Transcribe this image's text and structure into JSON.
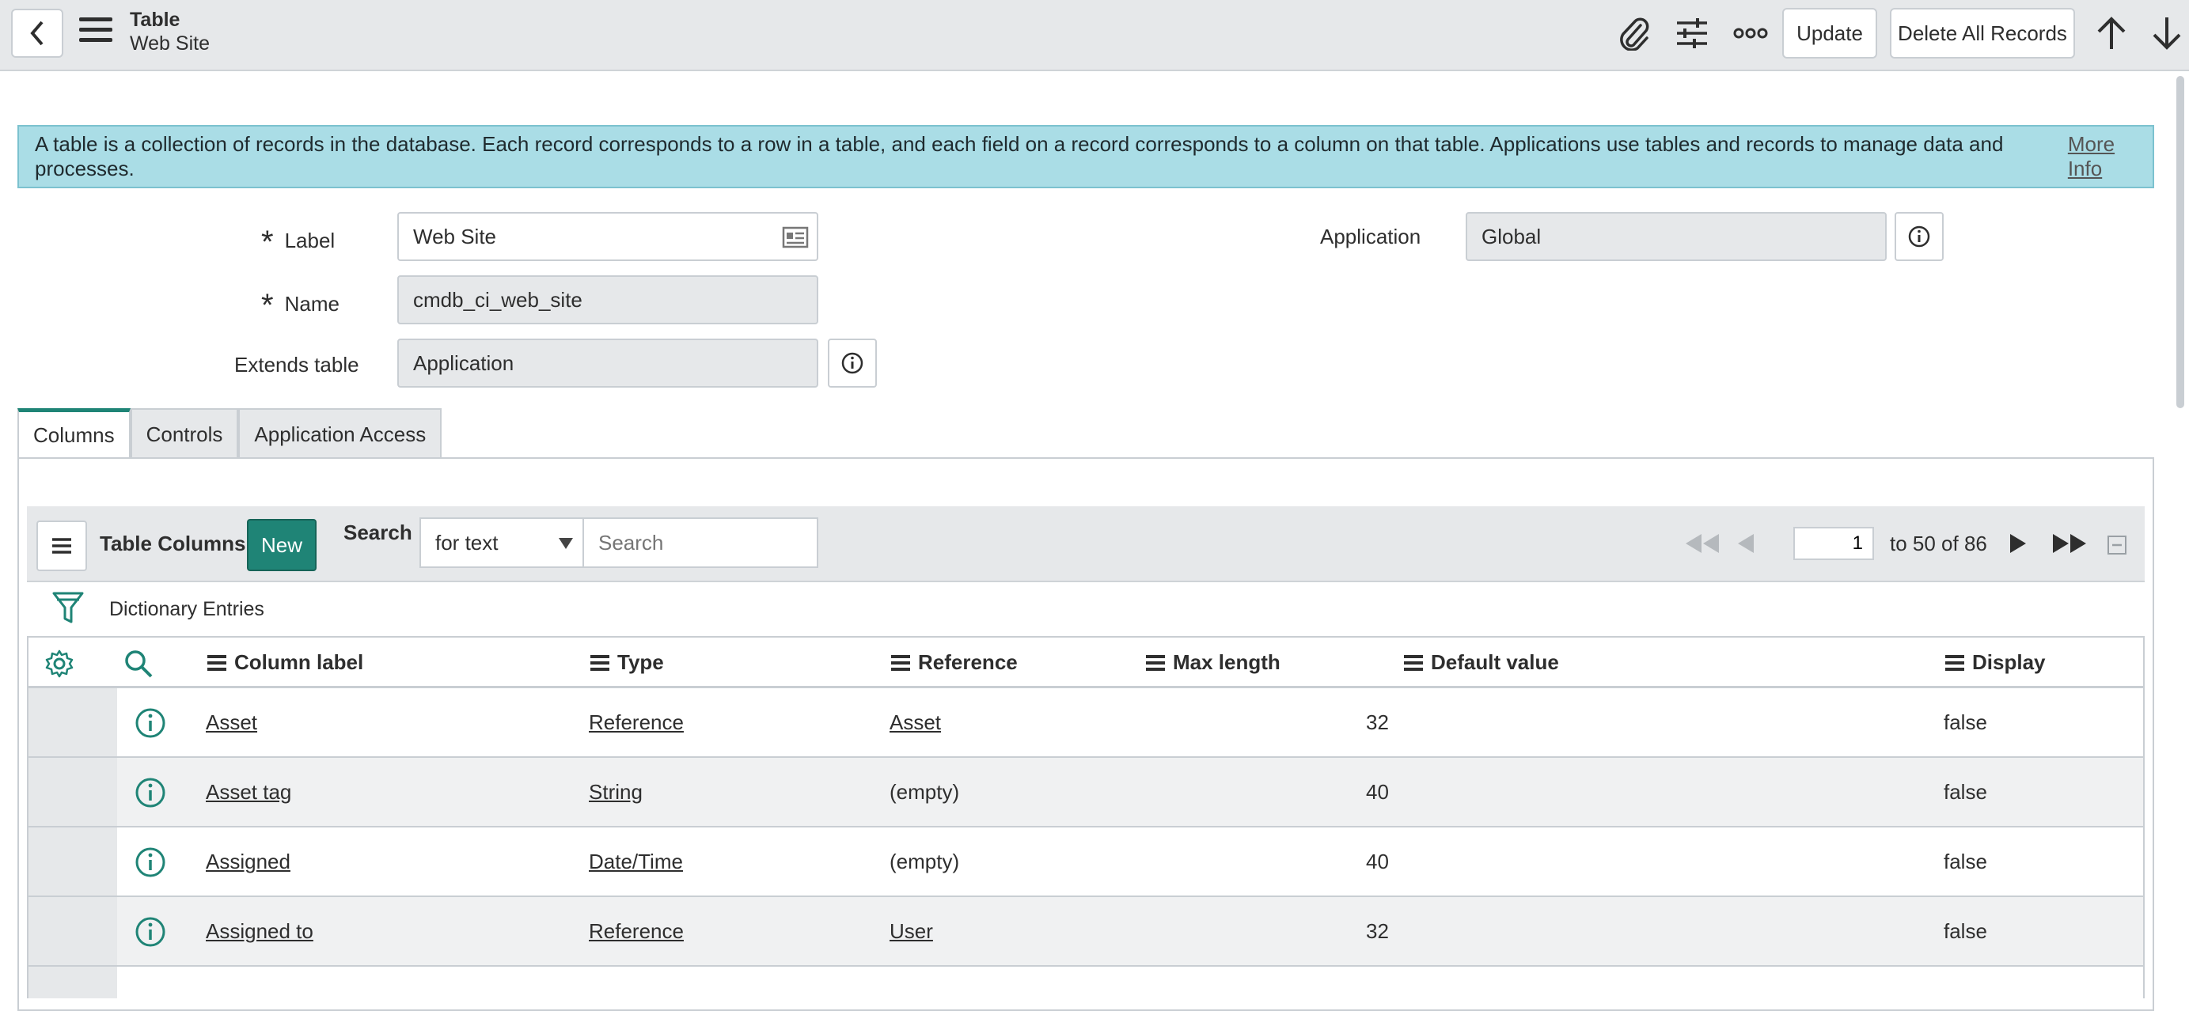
{
  "header": {
    "title": "Table",
    "subtitle": "Web Site",
    "update_label": "Update",
    "delete_all_label": "Delete All Records"
  },
  "info_message": {
    "text": "A table is a collection of records in the database. Each record corresponds to a row in a table, and each field on a record corresponds to a column on that table. Applications use tables and records to manage data and processes.",
    "link": "More Info"
  },
  "form": {
    "label_label": "Label",
    "label_value": "Web Site",
    "name_label": "Name",
    "name_value": "cmdb_ci_web_site",
    "extends_label": "Extends table",
    "extends_value": "Application",
    "application_label": "Application",
    "application_value": "Global"
  },
  "tabs": [
    "Columns",
    "Controls",
    "Application Access"
  ],
  "list": {
    "title": "Table Columns",
    "new_label": "New",
    "search_label": "Search",
    "search_select_value": "for text",
    "search_placeholder": "Search",
    "page_value": "1",
    "page_of": "to 50 of 86",
    "breadcrumb": "Dictionary Entries"
  },
  "columns": [
    "Column label",
    "Type",
    "Reference",
    "Max length",
    "Default value",
    "Display"
  ],
  "rows": [
    {
      "label": "Asset",
      "type": "Reference",
      "reference": "Asset",
      "reference_link": true,
      "max_length": "32",
      "default_value": "",
      "display": "false"
    },
    {
      "label": "Asset tag",
      "type": "String",
      "reference": "(empty)",
      "reference_link": false,
      "max_length": "40",
      "default_value": "",
      "display": "false"
    },
    {
      "label": "Assigned",
      "type": "Date/Time",
      "reference": "(empty)",
      "reference_link": false,
      "max_length": "40",
      "default_value": "",
      "display": "false"
    },
    {
      "label": "Assigned to",
      "type": "Reference",
      "reference": "User",
      "reference_link": true,
      "max_length": "32",
      "default_value": "",
      "display": "false"
    }
  ],
  "colors": {
    "accent": "#1f8476",
    "info_bg": "#aadde6",
    "toolbar_bg": "#e6e8ea"
  },
  "icons": [
    "back-icon",
    "menu-icon",
    "attachment-icon",
    "settings-sliders-icon",
    "more-icon",
    "arrow-up-icon",
    "arrow-down-icon",
    "info-icon",
    "filter-icon",
    "gear-icon",
    "search-icon"
  ]
}
